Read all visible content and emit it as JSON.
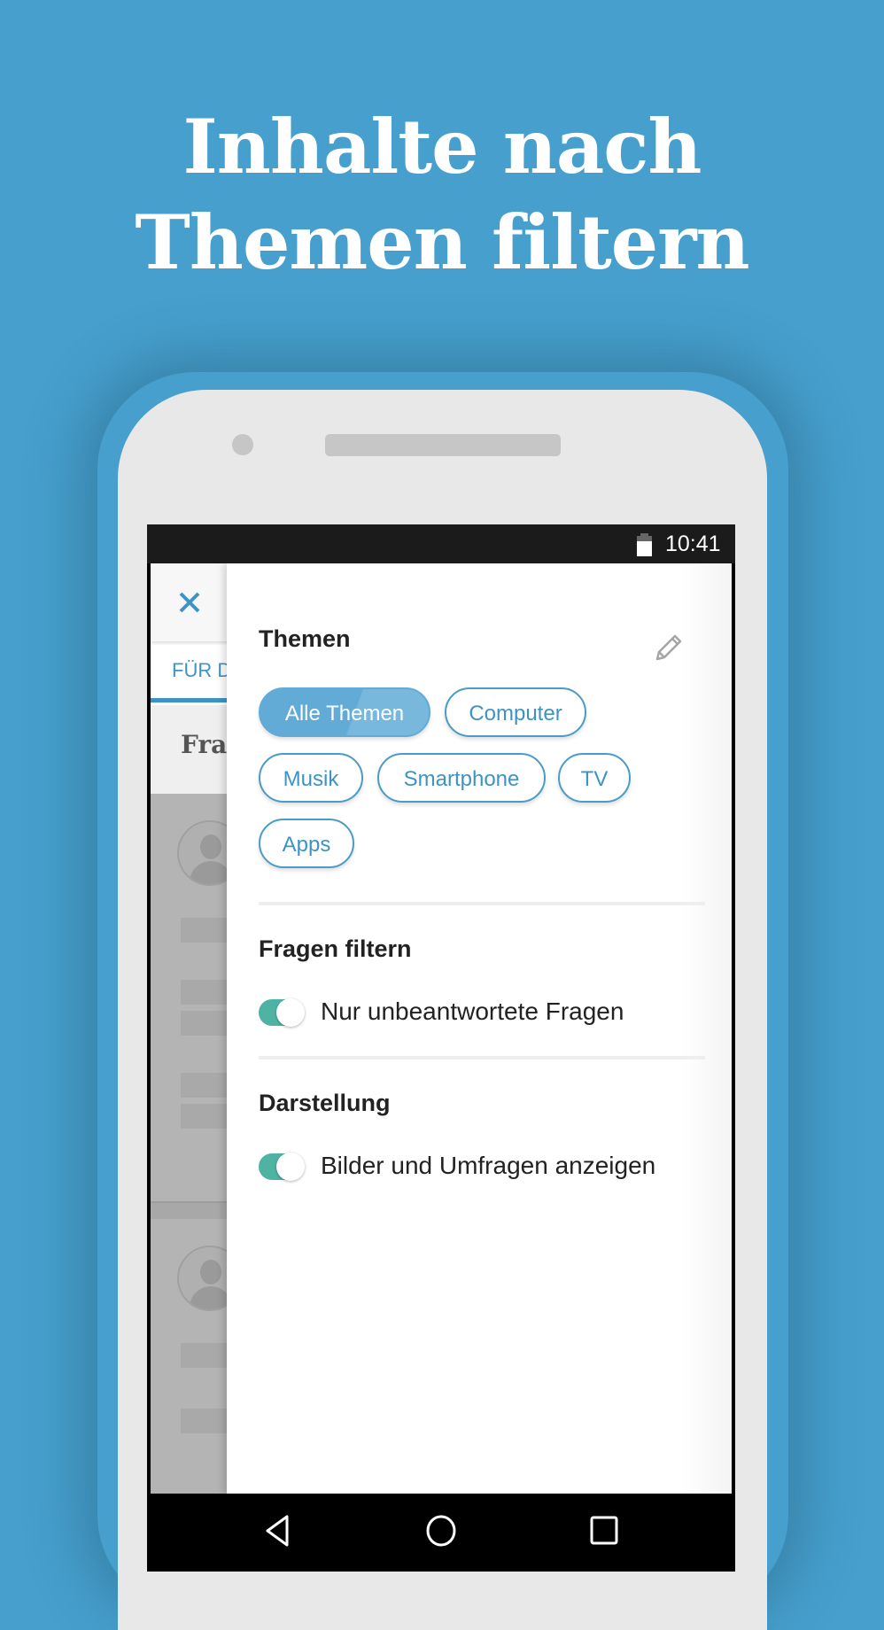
{
  "headline": {
    "line1": "Inhalte nach",
    "line2": "Themen filtern"
  },
  "status_bar": {
    "time": "10:41",
    "battery_icon": "battery-icon"
  },
  "background_screen": {
    "close_icon": "close-icon",
    "tab_label": "FÜR D",
    "heading": "Frag"
  },
  "filter_panel": {
    "topics": {
      "title": "Themen",
      "edit_icon": "pencil-icon",
      "chips": [
        {
          "label": "Alle Themen",
          "selected": true
        },
        {
          "label": "Computer",
          "selected": false
        },
        {
          "label": "Musik",
          "selected": false
        },
        {
          "label": "Smartphone",
          "selected": false
        },
        {
          "label": "TV",
          "selected": false
        },
        {
          "label": "Apps",
          "selected": false
        }
      ]
    },
    "question_filter": {
      "title": "Fragen filtern",
      "toggle_label": "Nur unbeantwortete Fragen",
      "toggle_on": true
    },
    "display": {
      "title": "Darstellung",
      "toggle_label": "Bilder und Umfragen anzeigen",
      "toggle_on": true
    }
  },
  "nav_bar": {
    "back_icon": "back-icon",
    "home_icon": "home-icon",
    "recents_icon": "recents-icon"
  },
  "colors": {
    "background": "#469fcc",
    "accent": "#3d94c4",
    "chip_selected": "#62abd6",
    "toggle_on": "#4fb3a3"
  }
}
